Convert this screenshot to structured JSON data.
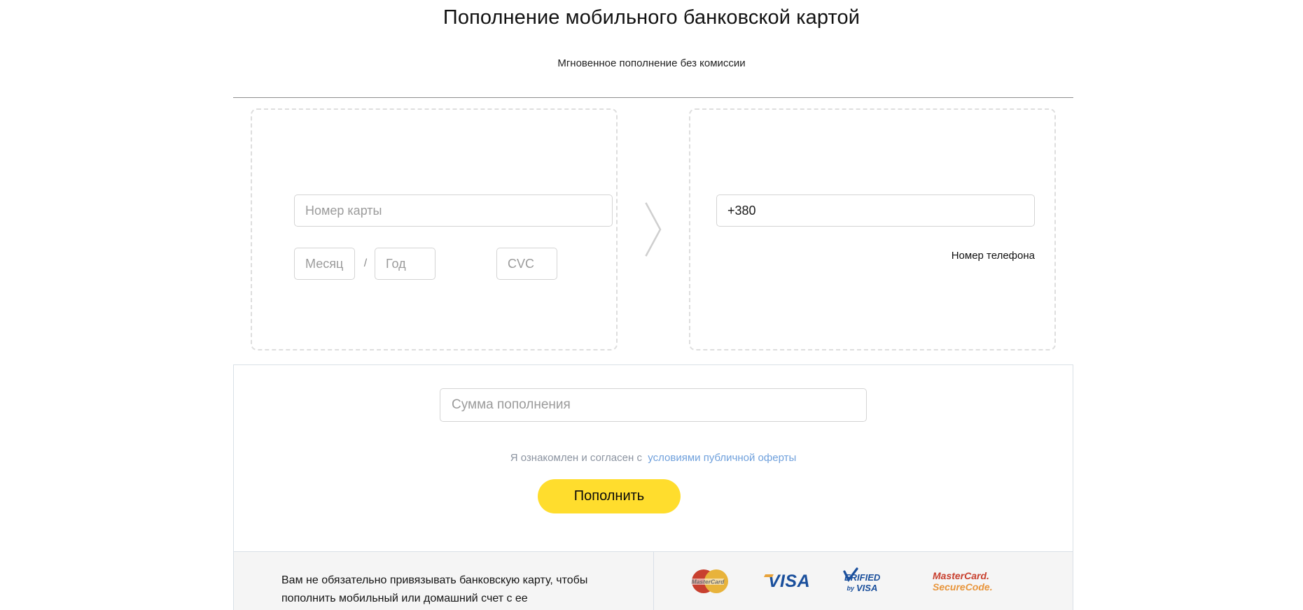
{
  "header": {
    "title": "Пополнение мобильного банковской картой",
    "subtitle": "Мгновенное пополнение без комиссии"
  },
  "card_panel": {
    "card_number_placeholder": "Номер карты",
    "card_number_value": "",
    "month_placeholder": "Месяц",
    "month_value": "",
    "separator": "/",
    "year_placeholder": "Год",
    "year_value": "",
    "cvc_placeholder": "CVC",
    "cvc_value": ""
  },
  "arrow_icon": "chevron-right-icon",
  "phone_panel": {
    "phone_placeholder": "+380",
    "phone_value": "+380",
    "caption": "Номер телефона"
  },
  "payment": {
    "amount_placeholder": "Сумма пополнения",
    "amount_value": "",
    "offer_text": "Я ознакомлен и согласен с",
    "offer_link": "условиями публичной оферты",
    "submit_label": "Пополнить",
    "submit_color": "#ffdd2d",
    "link_color": "#6fa0dc"
  },
  "footer": {
    "note": "Вам не обязательно привязывать банковскую карту, чтобы пополнить мобильный или домашний счет с ее",
    "logos": [
      {
        "name": "mastercard-logo",
        "label": "MasterCard"
      },
      {
        "name": "visa-logo",
        "label": "VISA"
      },
      {
        "name": "verified-by-visa-logo",
        "label": "Verified by VISA"
      },
      {
        "name": "mastercard-securecode-logo",
        "label": "MasterCard SecureCode"
      }
    ]
  }
}
